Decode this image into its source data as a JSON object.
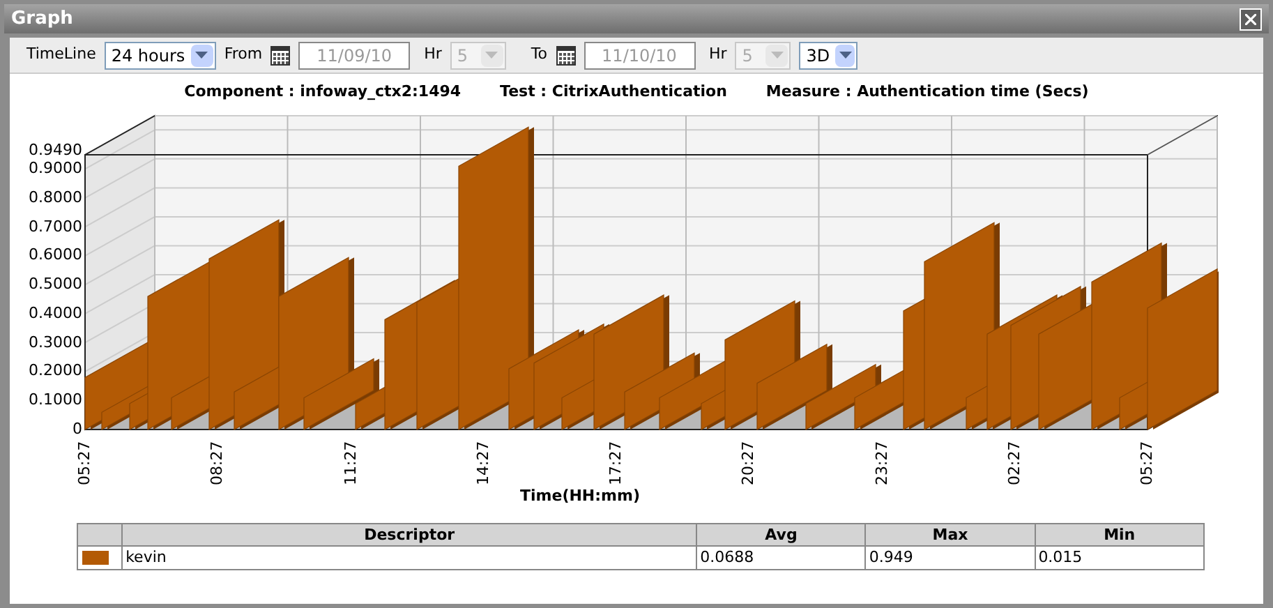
{
  "window": {
    "title": "Graph"
  },
  "toolbar": {
    "timeline_label": "TimeLine",
    "timeline": {
      "value": "24 hours",
      "disabled": false
    },
    "from_label": "From",
    "from_date": {
      "value": "11/09/10",
      "disabled": true
    },
    "from_hr_label": "Hr",
    "from_hr": {
      "value": "5",
      "disabled": true
    },
    "to_label": "To",
    "to_date": {
      "value": "11/10/10",
      "disabled": true
    },
    "to_hr_label": "Hr",
    "to_hr": {
      "value": "5",
      "disabled": true
    },
    "view": {
      "value": "3D",
      "disabled": false
    }
  },
  "chart_header": [
    "Component : infoway_ctx2:1494",
    "Test : CitrixAuthentication",
    "Measure : Authentication time  (Secs)"
  ],
  "chart": {
    "y_axis_labels": [
      "0.9490",
      "0.9000",
      "0.8000",
      "0.7000",
      "0.6000",
      "0.5000",
      "0.4000",
      "0.3000",
      "0.2000",
      "0.1000",
      "0"
    ],
    "x_axis_labels": [
      "05:27",
      "08:27",
      "11:27",
      "14:27",
      "17:27",
      "20:27",
      "23:27",
      "02:27",
      "05:27"
    ],
    "x_axis_title": "Time(HH:mm)"
  },
  "table": {
    "columns": [
      "Descriptor",
      "Avg",
      "Max",
      "Min"
    ],
    "rows": [
      {
        "color": "#b35a05",
        "cells": [
          "kevin",
          "0.0688",
          "0.949",
          "0.015"
        ]
      }
    ]
  }
}
